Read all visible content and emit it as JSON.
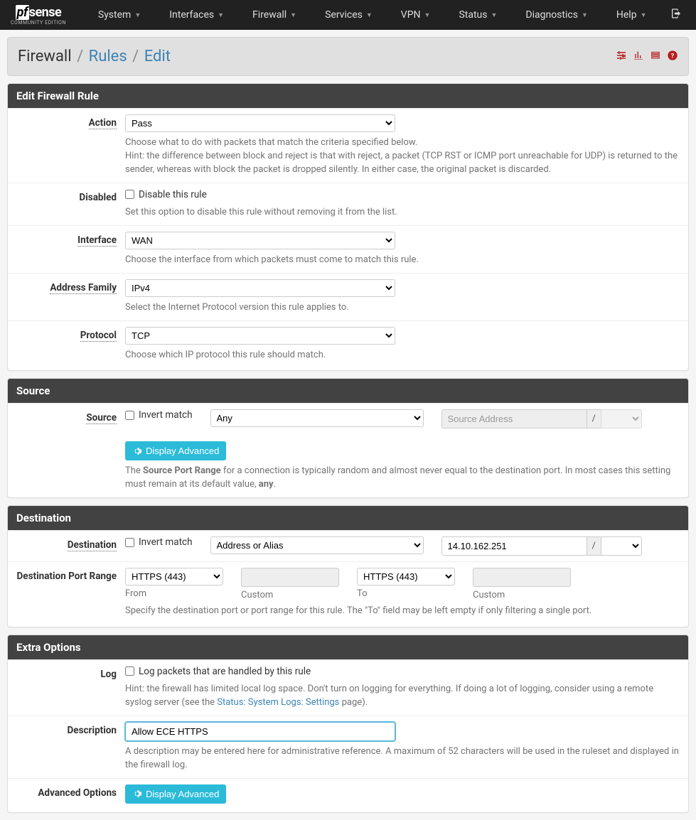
{
  "nav": {
    "items": [
      "System",
      "Interfaces",
      "Firewall",
      "Services",
      "VPN",
      "Status",
      "Diagnostics",
      "Help"
    ],
    "brand_sub": "COMMUNITY EDITION"
  },
  "breadcrumbs": {
    "a": "Firewall",
    "b": "Rules",
    "c": "Edit"
  },
  "panels": {
    "edit": "Edit Firewall Rule",
    "source": "Source",
    "destination": "Destination",
    "extra": "Extra Options"
  },
  "labels": {
    "action": "Action",
    "disabled": "Disabled",
    "interface": "Interface",
    "address_family": "Address Family",
    "protocol": "Protocol",
    "source": "Source",
    "destination": "Destination",
    "dest_port_range": "Destination Port Range",
    "log": "Log",
    "description": "Description",
    "advanced_options": "Advanced Options"
  },
  "values": {
    "action": "Pass",
    "interface": "WAN",
    "address_family": "IPv4",
    "protocol": "TCP",
    "source_type": "Any",
    "source_addr_placeholder": "Source Address",
    "mask_sep": "/",
    "destination_type": "Address or Alias",
    "destination_addr": "14.10.162.251",
    "port_from": "HTTPS (443)",
    "port_to": "HTTPS (443)",
    "description": "Allow ECE HTTPS"
  },
  "checkboxes": {
    "disable_rule": "Disable this rule",
    "invert_match": "Invert match",
    "log_packets": "Log packets that are handled by this rule"
  },
  "buttons": {
    "display_advanced": "Display Advanced"
  },
  "port_labels": {
    "from": "From",
    "custom": "Custom",
    "to": "To"
  },
  "help": {
    "action1": "Choose what to do with packets that match the criteria specified below.",
    "action2": "Hint: the difference between block and reject is that with reject, a packet (TCP RST or ICMP port unreachable for UDP) is returned to the sender, whereas with block the packet is dropped silently. In either case, the original packet is discarded.",
    "disabled": "Set this option to disable this rule without removing it from the list.",
    "interface": "Choose the interface from which packets must come to match this rule.",
    "address_family": "Select the Internet Protocol version this rule applies to.",
    "protocol": "Choose which IP protocol this rule should match.",
    "source_pre": "The ",
    "source_bold": "Source Port Range",
    "source_mid": " for a connection is typically random and almost never equal to the destination port. In most cases this setting must remain at its default value, ",
    "source_bold2": "any",
    "source_post": ".",
    "dest_port": "Specify the destination port or port range for this rule. The \"To\" field may be left empty if only filtering a single port.",
    "log_pre": "Hint: the firewall has limited local log space. Don't turn on logging for everything. If doing a lot of logging, consider using a remote syslog server (see the ",
    "log_link": "Status: System Logs: Settings",
    "log_post": " page).",
    "description": "A description may be entered here for administrative reference. A maximum of 52 characters will be used in the ruleset and displayed in the firewall log."
  }
}
